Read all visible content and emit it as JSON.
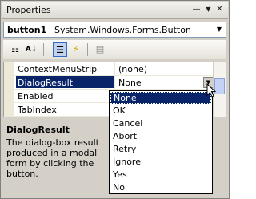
{
  "window": {
    "title": "Properties",
    "pin_glyph": "—",
    "menu_glyph": "▼",
    "close_glyph": "✕"
  },
  "object_selector": {
    "name": "button1",
    "type": "System.Windows.Forms.Button",
    "arrow": "▼"
  },
  "toolbar": {
    "categorized_glyph": "☷",
    "alphabetical_glyph": "A↓",
    "properties_glyph": "☰",
    "events_glyph": "⚡",
    "pages_glyph": "▤"
  },
  "grid": {
    "rows": [
      {
        "name": "ContextMenuStrip",
        "value": "(none)"
      },
      {
        "name": "DialogResult",
        "value": "None"
      },
      {
        "name": "Enabled",
        "value": ""
      },
      {
        "name": "TabIndex",
        "value": ""
      }
    ],
    "dropdown_arrow": "▼"
  },
  "description": {
    "title": "DialogResult",
    "text": "The dialog-box result produced in a modal form by clicking the button."
  },
  "dropdown": {
    "items": [
      "None",
      "OK",
      "Cancel",
      "Abort",
      "Retry",
      "Ignore",
      "Yes",
      "No"
    ],
    "selected": "None"
  },
  "colors": {
    "selection": "#0a246a",
    "window_bg": "#d4d0c8"
  }
}
